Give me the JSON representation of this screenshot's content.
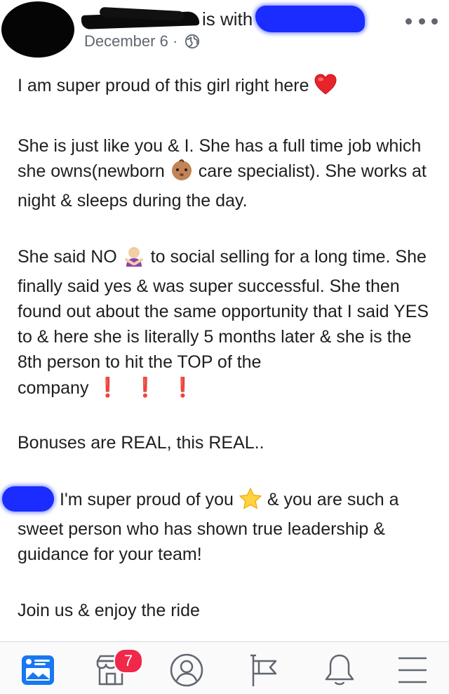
{
  "header": {
    "name_partial": "is with",
    "date": "December 6",
    "separator": "·",
    "privacy_icon": "globe-icon",
    "more_icon": "more-icon"
  },
  "post": {
    "line1": "I am super proud of this girl right here",
    "line1_emoji": "❤️",
    "para2_a": "She is just like you & I. She has a full time job which she owns(newborn",
    "para2_emoji": "👶🏽",
    "para2_b": "care specialist). She works at night & sleeps during the day.",
    "para3_a": "She said NO",
    "para3_emoji": "🙅🏼‍♀️",
    "para3_b": "to social selling for a long time. She finally said yes & was super successful. She then found out about the same opportunity that I said YES to & here she is literally 5 months later & she is the 8th person to hit the TOP of the",
    "para3_c": "company",
    "exclaims": [
      "❗",
      "❗",
      "❗"
    ],
    "para4": "Bonuses are REAL, this REAL..",
    "para5_a": "I'm super proud of you",
    "para5_emoji": "⭐",
    "para5_b": "& you are such a sweet person who has shown true leadership & guidance for your team!",
    "para6": "Join us & enjoy the ride"
  },
  "tabbar": {
    "items": [
      {
        "icon": "news-feed-icon"
      },
      {
        "icon": "marketplace-icon"
      },
      {
        "icon": "profile-icon"
      },
      {
        "icon": "pages-flag-icon"
      },
      {
        "icon": "notifications-bell-icon"
      },
      {
        "icon": "menu-icon"
      }
    ],
    "marketplace_badge": "7",
    "colors": {
      "active": "#1877f2",
      "inactive": "#606770",
      "badge": "#f02849"
    }
  }
}
